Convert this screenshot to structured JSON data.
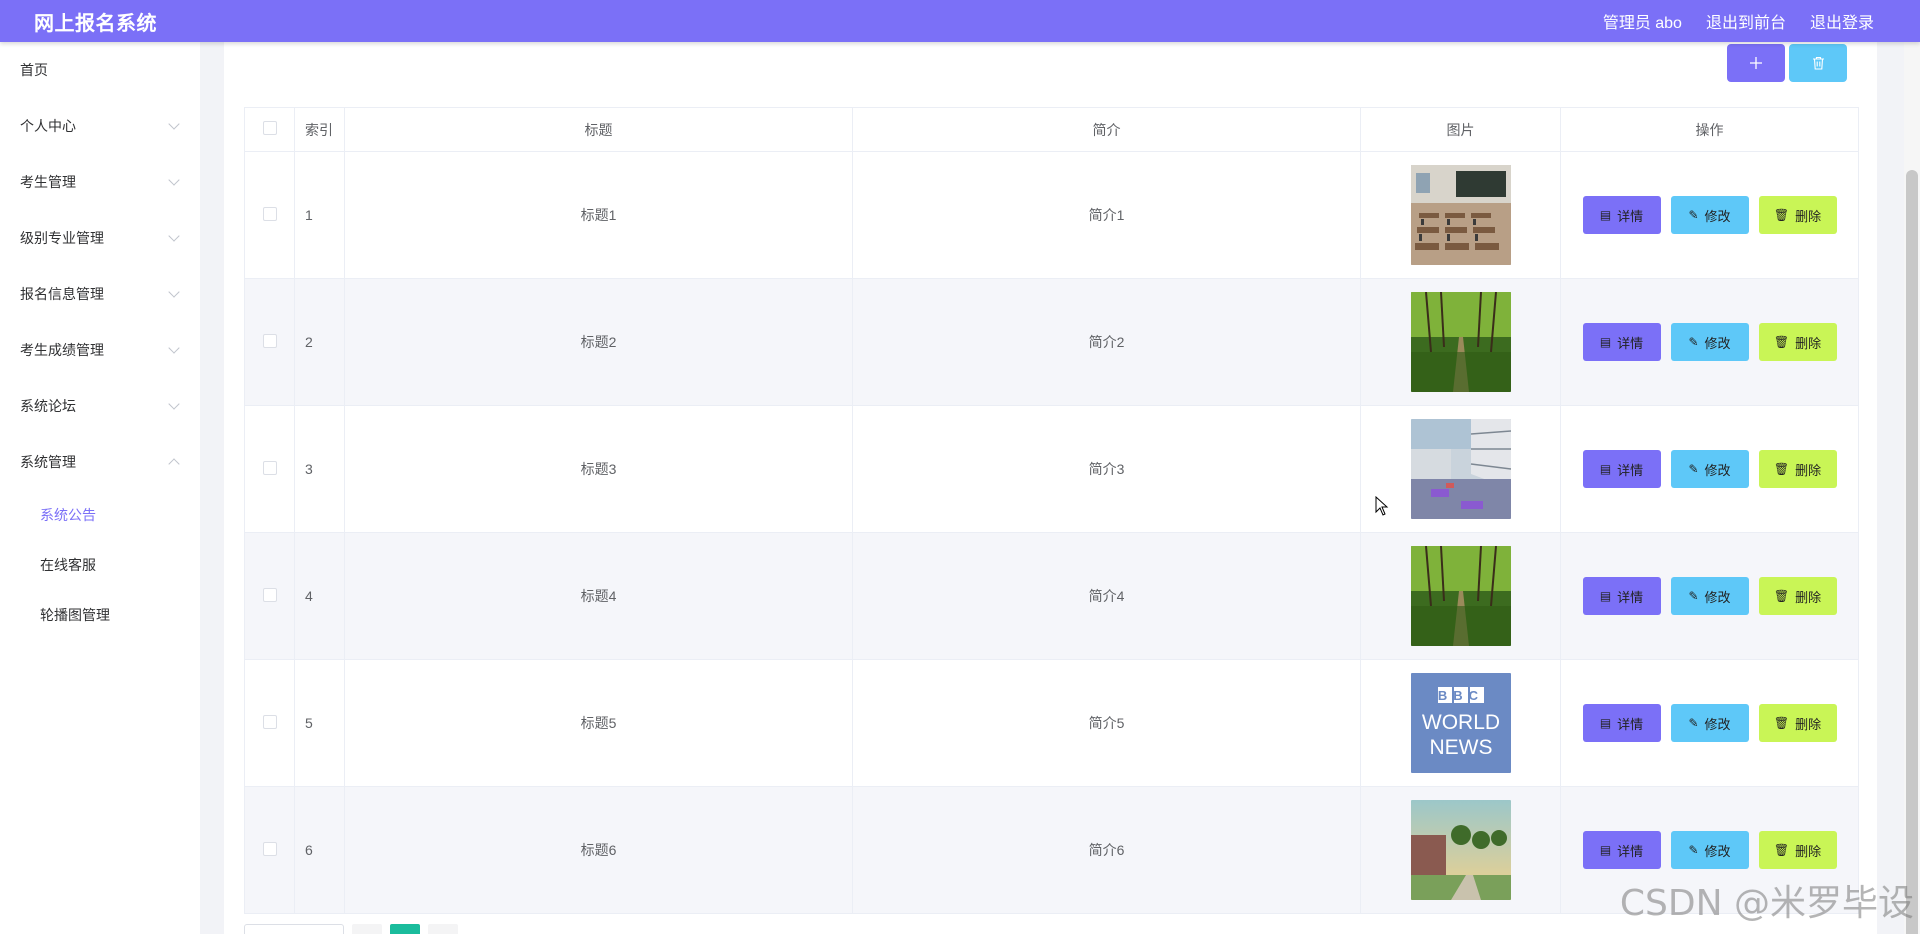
{
  "header": {
    "title": "网上报名系统",
    "user": "管理员 abo",
    "to_front": "退出到前台",
    "logout": "退出登录",
    "color": "#7b70f7"
  },
  "sidebar": {
    "items": [
      {
        "label": "首页",
        "has_arrow": false
      },
      {
        "label": "个人中心",
        "has_arrow": true
      },
      {
        "label": "考生管理",
        "has_arrow": true
      },
      {
        "label": "级别专业管理",
        "has_arrow": true
      },
      {
        "label": "报名信息管理",
        "has_arrow": true
      },
      {
        "label": "考生成绩管理",
        "has_arrow": true
      },
      {
        "label": "系统论坛",
        "has_arrow": true
      },
      {
        "label": "系统管理",
        "expanded": true
      }
    ],
    "submenu": [
      {
        "label": "系统公告",
        "active": true
      },
      {
        "label": "在线客服"
      },
      {
        "label": "轮播图管理"
      }
    ]
  },
  "toolbar": {
    "add_icon": "plus-icon",
    "delete_icon": "trash-icon"
  },
  "table": {
    "headers": {
      "index": "索引",
      "title": "标题",
      "summary": "简介",
      "image": "图片",
      "actions": "操作"
    },
    "rows": [
      {
        "index": "1",
        "title": "标题1",
        "summary": "简介1",
        "image": "classroom"
      },
      {
        "index": "2",
        "title": "标题2",
        "summary": "简介2",
        "image": "forest-path"
      },
      {
        "index": "3",
        "title": "标题3",
        "summary": "简介3",
        "image": "campus-building"
      },
      {
        "index": "4",
        "title": "标题4",
        "summary": "简介4",
        "image": "forest-path"
      },
      {
        "index": "5",
        "title": "标题5",
        "summary": "简介5",
        "image": "bbc-world-news"
      },
      {
        "index": "6",
        "title": "标题6",
        "summary": "简介6",
        "image": "campus-sunset"
      }
    ],
    "actions": {
      "detail": "详情",
      "edit": "修改",
      "delete": "删除"
    }
  },
  "bbc_logo": {
    "line1": "BBC",
    "line2": "WORLD",
    "line3": "NEWS"
  },
  "watermark": "CSDN @米罗毕设"
}
